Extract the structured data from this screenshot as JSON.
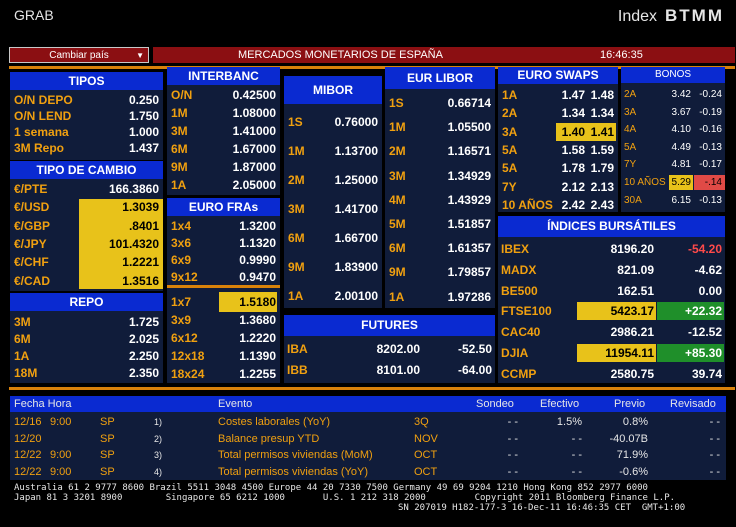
{
  "header": {
    "app": "GRAB",
    "index_label": "Index",
    "index_code": "BTMM"
  },
  "menu": {
    "country_select": "Cambiar país",
    "banner_title": "MERCADOS MONETARIOS DE ESPAÑA",
    "clock": "16:46:35"
  },
  "tipos": {
    "title": "TIPOS",
    "rows": [
      {
        "label": "O/N DEPO",
        "value": "0.250"
      },
      {
        "label": "O/N LEND",
        "value": "1.750"
      },
      {
        "label": "1 semana",
        "value": "1.000"
      },
      {
        "label": "3M Repo",
        "value": "1.437"
      }
    ]
  },
  "cambio": {
    "title": "TIPO DE CAMBIO",
    "rows": [
      {
        "label": "€/PTE",
        "value": "166.3860"
      },
      {
        "label": "€/USD",
        "value": "1.3039"
      },
      {
        "label": "€/GBP",
        "value": ".8401"
      },
      {
        "label": "€/JPY",
        "value": "101.4320"
      },
      {
        "label": "€/CHF",
        "value": "1.2221"
      },
      {
        "label": "€/CAD",
        "value": "1.3516"
      }
    ]
  },
  "repo": {
    "title": "REPO",
    "rows": [
      {
        "label": "3M",
        "value": "1.725"
      },
      {
        "label": "6M",
        "value": "2.025"
      },
      {
        "label": "1A",
        "value": "2.250"
      },
      {
        "label": "18M",
        "value": "2.350"
      }
    ]
  },
  "interbanc": {
    "title": "INTERBANC",
    "rows": [
      {
        "label": "O/N",
        "value": "0.42500"
      },
      {
        "label": "1M",
        "value": "1.08000"
      },
      {
        "label": "3M",
        "value": "1.41000"
      },
      {
        "label": "6M",
        "value": "1.67000"
      },
      {
        "label": "9M",
        "value": "1.87000"
      },
      {
        "label": "1A",
        "value": "2.05000"
      }
    ]
  },
  "eurofras": {
    "title": "EURO FRAs",
    "rows": [
      {
        "label": "1x4",
        "value": "1.3200"
      },
      {
        "label": "3x6",
        "value": "1.1320"
      },
      {
        "label": "6x9",
        "value": "0.9990"
      },
      {
        "label": "9x12",
        "value": "0.9470"
      },
      {
        "label": "1x7",
        "value": "1.5180"
      },
      {
        "label": "3x9",
        "value": "1.3680"
      },
      {
        "label": "6x12",
        "value": "1.2220"
      },
      {
        "label": "12x18",
        "value": "1.1390"
      },
      {
        "label": "18x24",
        "value": "1.2255"
      }
    ]
  },
  "mibor": {
    "title": "MIBOR",
    "rows": [
      {
        "label": "1S",
        "value": "0.76000"
      },
      {
        "label": "1M",
        "value": "1.13700"
      },
      {
        "label": "2M",
        "value": "1.25000"
      },
      {
        "label": "3M",
        "value": "1.41700"
      },
      {
        "label": "6M",
        "value": "1.66700"
      },
      {
        "label": "9M",
        "value": "1.83900"
      },
      {
        "label": "1A",
        "value": "2.00100"
      }
    ]
  },
  "eurlibor": {
    "title": "EUR LIBOR",
    "rows": [
      {
        "label": "1S",
        "value": "0.66714"
      },
      {
        "label": "1M",
        "value": "1.05500"
      },
      {
        "label": "2M",
        "value": "1.16571"
      },
      {
        "label": "3M",
        "value": "1.34929"
      },
      {
        "label": "4M",
        "value": "1.43929"
      },
      {
        "label": "5M",
        "value": "1.51857"
      },
      {
        "label": "6M",
        "value": "1.61357"
      },
      {
        "label": "9M",
        "value": "1.79857"
      },
      {
        "label": "1A",
        "value": "1.97286"
      }
    ]
  },
  "futures": {
    "title": "FUTURES",
    "rows": [
      {
        "label": "IBA",
        "value": "8202.00",
        "change": "-52.50"
      },
      {
        "label": "IBB",
        "value": "8101.00",
        "change": "-64.00"
      }
    ]
  },
  "euroswaps": {
    "title": "EURO SWAPS",
    "rows": [
      {
        "label": "1A",
        "bid": "1.47",
        "ask": "1.48"
      },
      {
        "label": "2A",
        "bid": "1.34",
        "ask": "1.34"
      },
      {
        "label": "3A",
        "bid": "1.40",
        "ask": "1.41"
      },
      {
        "label": "5A",
        "bid": "1.58",
        "ask": "1.59"
      },
      {
        "label": "5A",
        "bid": "1.78",
        "ask": "1.79"
      },
      {
        "label": "7Y",
        "bid": "2.12",
        "ask": "2.13"
      },
      {
        "label": "10 AÑOS",
        "bid": "2.42",
        "ask": "2.43"
      }
    ]
  },
  "bonos": {
    "title": "BONOS",
    "rows": [
      {
        "label": "2A",
        "value": "3.42",
        "change": "-0.24"
      },
      {
        "label": "3A",
        "value": "3.67",
        "change": "-0.19"
      },
      {
        "label": "4A",
        "value": "4.10",
        "change": "-0.16"
      },
      {
        "label": "5A",
        "value": "4.49",
        "change": "-0.13"
      },
      {
        "label": "7Y",
        "value": "4.81",
        "change": "-0.17"
      },
      {
        "label": "10 AÑOS",
        "value": "5.29",
        "change": "-.14"
      },
      {
        "label": "30A",
        "value": "6.15",
        "change": "-0.13"
      }
    ]
  },
  "indices": {
    "title": "ÍNDICES BURSÁTILES",
    "rows": [
      {
        "label": "IBEX",
        "value": "8196.20",
        "change": "-54.20"
      },
      {
        "label": "MADX",
        "value": "821.09",
        "change": "-4.62"
      },
      {
        "label": "BE500",
        "value": "162.51",
        "change": "0.00"
      },
      {
        "label": "FTSE100",
        "value": "5423.17",
        "change": "+22.32"
      },
      {
        "label": "CAC40",
        "value": "2986.21",
        "change": "-12.52"
      },
      {
        "label": "DJIA",
        "value": "11954.11",
        "change": "+85.30"
      },
      {
        "label": "CCMP",
        "value": "2580.75",
        "change": "39.74"
      }
    ]
  },
  "events": {
    "headers": {
      "date": "Fecha Hora",
      "event": "Evento",
      "survey": "Sondeo",
      "actual": "Efectivo",
      "prior": "Previo",
      "revised": "Revisado"
    },
    "rows": [
      {
        "date": "12/16",
        "time": "9:00",
        "country": "SP",
        "num": "1)",
        "event": "Costes laborales (YoY)",
        "period": "3Q",
        "survey": "- -",
        "actual": "1.5%",
        "prior": "0.8%",
        "revised": "- -"
      },
      {
        "date": "12/20",
        "time": "",
        "country": "SP",
        "num": "2)",
        "event": "Balance presup YTD",
        "period": "NOV",
        "survey": "- -",
        "actual": "- -",
        "prior": "-40.07B",
        "revised": "- -"
      },
      {
        "date": "12/22",
        "time": "9:00",
        "country": "SP",
        "num": "3)",
        "event": "Total permisos viviendas (MoM)",
        "period": "OCT",
        "survey": "- -",
        "actual": "- -",
        "prior": "71.9%",
        "revised": "- -"
      },
      {
        "date": "12/22",
        "time": "9:00",
        "country": "SP",
        "num": "4)",
        "event": "Total permisos viviendas (YoY)",
        "period": "OCT",
        "survey": "- -",
        "actual": "- -",
        "prior": "-0.6%",
        "revised": "- -"
      }
    ]
  },
  "footer": {
    "line1": "Australia 61 2 9777 8600 Brazil 5511 3048 4500 Europe 44 20 7330 7500 Germany 49 69 9204 1210 Hong Kong 852 2977 6000",
    "line2": "Japan 81 3 3201 8900        Singapore 65 6212 1000       U.S. 1 212 318 2000         Copyright 2011 Bloomberg Finance L.P.",
    "line3": "SN 207019 H182-177-3 16-Dec-11 16:46:35 CET  GMT+1:00"
  },
  "colors": {
    "label": "#f0a010",
    "header": "#0a2ad1",
    "panel": "#101c3a",
    "highlight": "#e8c21a",
    "up": "#1f8f2a",
    "down": "#e04a46"
  }
}
